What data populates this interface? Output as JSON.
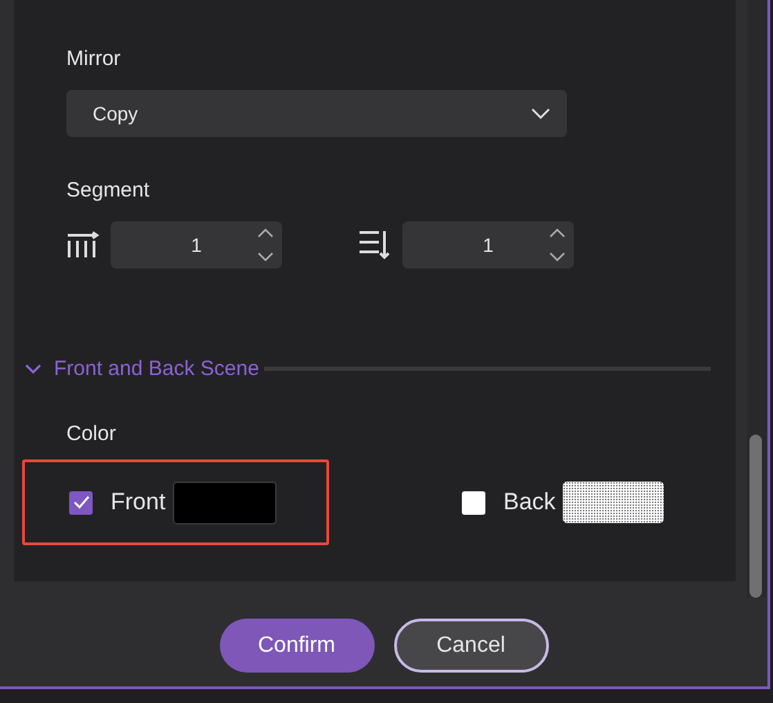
{
  "mirror": {
    "label": "Mirror",
    "value": "Copy"
  },
  "segment": {
    "label": "Segment",
    "spinners": [
      {
        "kind": "columns",
        "value": "1"
      },
      {
        "kind": "rows",
        "value": "1"
      }
    ]
  },
  "section": {
    "title": "Front and Back Scene",
    "expanded": true
  },
  "color": {
    "label": "Color",
    "options": [
      {
        "label": "Front",
        "checked": true,
        "highlighted": true,
        "kind": "solid",
        "color": "#000000"
      },
      {
        "label": "Back",
        "checked": false,
        "highlighted": false,
        "kind": "pattern"
      }
    ]
  },
  "buttons": [
    {
      "label": "Confirm",
      "kind": "primary"
    },
    {
      "label": "Cancel",
      "kind": "secondary"
    }
  ]
}
